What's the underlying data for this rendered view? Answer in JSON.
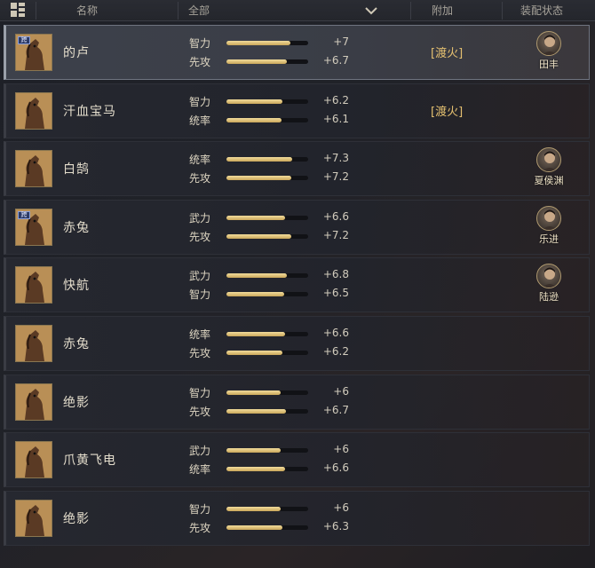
{
  "header": {
    "name_label": "名称",
    "filter_label": "全部",
    "attach_label": "附加",
    "equip_label": "装配状态"
  },
  "rows": [
    {
      "name": "的卢",
      "cross_server": "跨",
      "selected": true,
      "stats": [
        {
          "label": "智力",
          "value": "+7",
          "fill": 0.78
        },
        {
          "label": "先攻",
          "value": "+6.7",
          "fill": 0.74
        }
      ],
      "attach": "[渡火]",
      "general": "田丰"
    },
    {
      "name": "汗血宝马",
      "selected": false,
      "stats": [
        {
          "label": "智力",
          "value": "+6.2",
          "fill": 0.68
        },
        {
          "label": "统率",
          "value": "+6.1",
          "fill": 0.67
        }
      ],
      "attach": "[渡火]",
      "general": ""
    },
    {
      "name": "白鹄",
      "selected": false,
      "stats": [
        {
          "label": "统率",
          "value": "+7.3",
          "fill": 0.8
        },
        {
          "label": "先攻",
          "value": "+7.2",
          "fill": 0.79
        }
      ],
      "attach": "",
      "general": "夏侯渊"
    },
    {
      "name": "赤兔",
      "cross_server": "跨",
      "selected": false,
      "stats": [
        {
          "label": "武力",
          "value": "+6.6",
          "fill": 0.72
        },
        {
          "label": "先攻",
          "value": "+7.2",
          "fill": 0.79
        }
      ],
      "attach": "",
      "general": "乐进"
    },
    {
      "name": "快航",
      "selected": false,
      "stats": [
        {
          "label": "武力",
          "value": "+6.8",
          "fill": 0.74
        },
        {
          "label": "智力",
          "value": "+6.5",
          "fill": 0.71
        }
      ],
      "attach": "",
      "general": "陆逊"
    },
    {
      "name": "赤兔",
      "selected": false,
      "stats": [
        {
          "label": "统率",
          "value": "+6.6",
          "fill": 0.72
        },
        {
          "label": "先攻",
          "value": "+6.2",
          "fill": 0.68
        }
      ],
      "attach": "",
      "general": ""
    },
    {
      "name": "绝影",
      "selected": false,
      "stats": [
        {
          "label": "智力",
          "value": "+6",
          "fill": 0.66
        },
        {
          "label": "先攻",
          "value": "+6.7",
          "fill": 0.73
        }
      ],
      "attach": "",
      "general": ""
    },
    {
      "name": "爪黄飞电",
      "selected": false,
      "stats": [
        {
          "label": "武力",
          "value": "+6",
          "fill": 0.66
        },
        {
          "label": "统率",
          "value": "+6.6",
          "fill": 0.72
        }
      ],
      "attach": "",
      "general": ""
    },
    {
      "name": "绝影",
      "selected": false,
      "stats": [
        {
          "label": "智力",
          "value": "+6",
          "fill": 0.66
        },
        {
          "label": "先攻",
          "value": "+6.3",
          "fill": 0.69
        }
      ],
      "attach": "",
      "general": ""
    }
  ],
  "colors": {
    "accent_gold": "#e5c070",
    "bar_fill": "#e6cd88",
    "selected_border": "#6f7480"
  },
  "icons": {
    "menu": "menu-grid-icon",
    "dropdown": "chevron-down-icon",
    "horse": "horse-portrait-icon",
    "general": "general-avatar-icon"
  }
}
